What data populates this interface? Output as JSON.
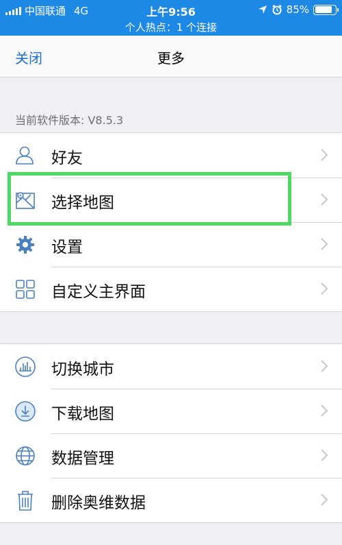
{
  "status_bar": {
    "carrier": "中国联通",
    "network": "4G",
    "time": "上午9:56",
    "battery_percent": "85%",
    "battery_level": 0.85,
    "hotspot": "个人热点：1 个连接"
  },
  "nav": {
    "close_label": "关闭",
    "title": "更多"
  },
  "version_label": "当前软件版本: V8.5.3",
  "group1": [
    {
      "label": "好友",
      "icon": "user-icon"
    },
    {
      "label": "选择地图",
      "icon": "map-icon"
    },
    {
      "label": "设置",
      "icon": "gear-icon"
    },
    {
      "label": "自定义主界面",
      "icon": "grid-icon"
    }
  ],
  "group2": [
    {
      "label": "切换城市",
      "icon": "city-icon"
    },
    {
      "label": "下载地图",
      "icon": "download-icon"
    },
    {
      "label": "数据管理",
      "icon": "globe-icon"
    },
    {
      "label": "删除奥维数据",
      "icon": "trash-icon"
    }
  ],
  "colors": {
    "accent": "#1e88e5",
    "link": "#1e6fd9",
    "icon": "#4a7fc1",
    "highlight": "#4cd964"
  }
}
